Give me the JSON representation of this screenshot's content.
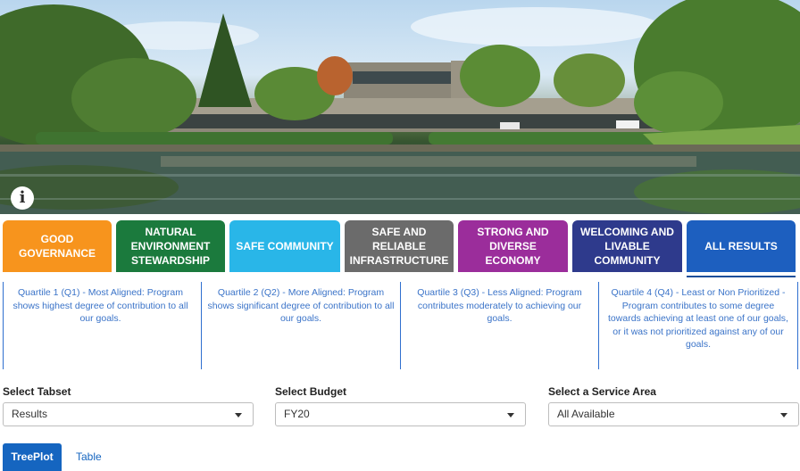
{
  "hero": {
    "info_icon": "info-circle-icon"
  },
  "tabs": [
    {
      "label": "GOOD GOVERNANCE",
      "color": "#f7941d"
    },
    {
      "label": "NATURAL ENVIRONMENT STEWARDSHIP",
      "color": "#1b7a3d"
    },
    {
      "label": "SAFE COMMUNITY",
      "color": "#29b6e8"
    },
    {
      "label": "SAFE AND RELIABLE INFRASTRUCTURE",
      "color": "#6b6b6b"
    },
    {
      "label": "STRONG AND DIVERSE ECONOMY",
      "color": "#9b2d9b"
    },
    {
      "label": "WELCOMING AND LIVABLE COMMUNITY",
      "color": "#2e3a8c"
    },
    {
      "label": "ALL RESULTS",
      "color": "#1d5fbf"
    }
  ],
  "quartiles": [
    "Quartile 1 (Q1) - Most Aligned: Program shows highest degree of contribution to all our goals.",
    "Quartile 2 (Q2) - More Aligned: Program shows significant degree of contribution to all our goals.",
    "Quartile 3 (Q3) - Less Aligned: Program contributes moderately to achieving our goals.",
    "Quartile 4 (Q4) - Least or Non Prioritized - Program contributes to some degree towards achieving at least one of our goals, or it was not prioritized against any of our goals."
  ],
  "filters": {
    "tabset": {
      "label": "Select Tabset",
      "value": "Results"
    },
    "budget": {
      "label": "Select Budget",
      "value": "FY20"
    },
    "service_area": {
      "label": "Select a Service Area",
      "value": "All Available"
    }
  },
  "view_tabs": {
    "treeplot": "TreePlot",
    "table": "Table"
  }
}
